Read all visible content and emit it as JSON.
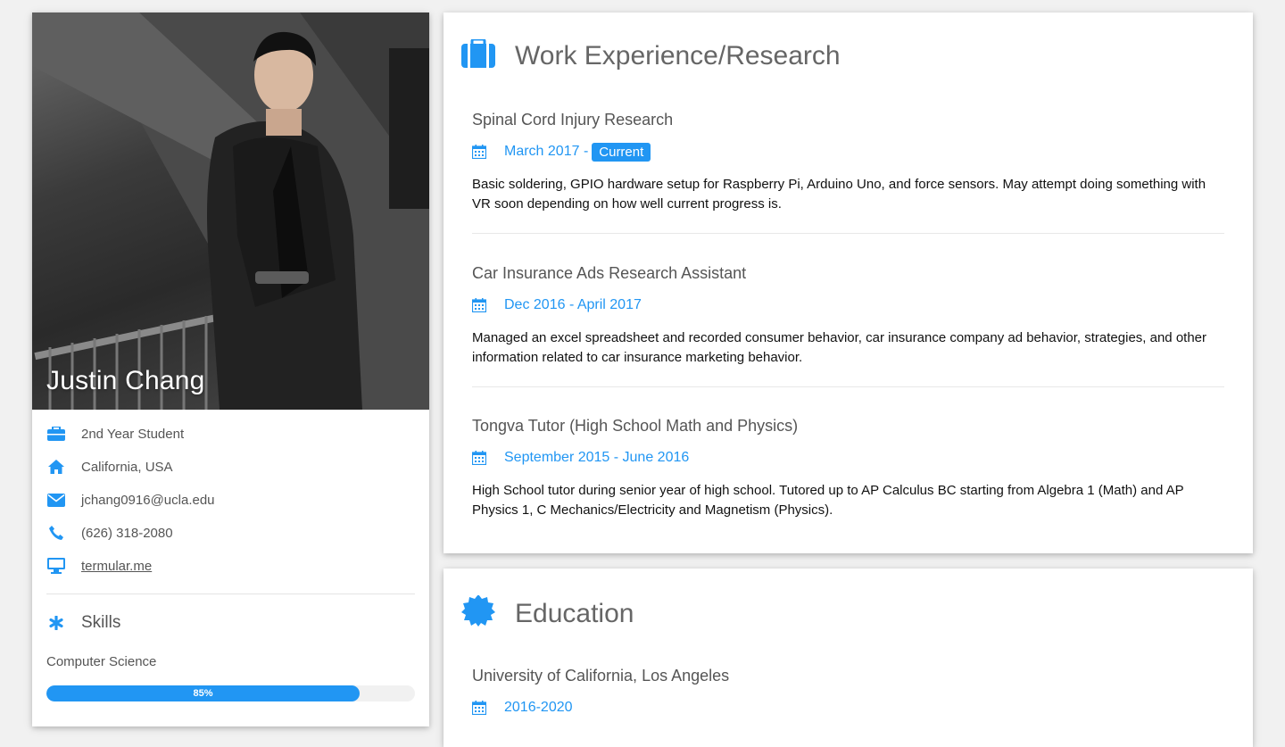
{
  "profile": {
    "name": "Justin Chang",
    "info": [
      {
        "icon": "briefcase-icon",
        "text": "2nd Year Student"
      },
      {
        "icon": "home-icon",
        "text": "California, USA"
      },
      {
        "icon": "envelope-icon",
        "text": "jchang0916@ucla.edu"
      },
      {
        "icon": "phone-icon",
        "text": "(626) 318-2080"
      },
      {
        "icon": "desktop-icon",
        "text": "termular.me"
      }
    ],
    "skills_title": "Skills",
    "skills": [
      {
        "label": "Computer Science",
        "percent": 85,
        "percent_label": "85%"
      }
    ]
  },
  "work": {
    "title": "Work Experience/Research",
    "entries": [
      {
        "title": "Spinal Cord Injury Research",
        "date": "March 2017 -",
        "badge": "Current",
        "description": "Basic soldering, GPIO hardware setup for Raspberry Pi, Arduino Uno, and force sensors. May attempt doing something with VR soon depending on how well current progress is."
      },
      {
        "title": "Car Insurance Ads Research Assistant",
        "date": "Dec 2016 - April 2017",
        "description": "Managed an excel spreadsheet and recorded consumer behavior, car insurance company ad behavior, strategies, and other information related to car insurance marketing behavior."
      },
      {
        "title": "Tongva Tutor (High School Math and Physics)",
        "date": "September 2015 - June 2016",
        "description": "High School tutor during senior year of high school. Tutored up to AP Calculus BC starting from Algebra 1 (Math) and AP Physics 1, C Mechanics/Electricity and Magnetism (Physics)."
      }
    ]
  },
  "education": {
    "title": "Education",
    "entries": [
      {
        "title": "University of California, Los Angeles",
        "date": "2016-2020"
      }
    ]
  },
  "colors": {
    "accent": "#2196F3",
    "background": "#f1f1f1",
    "card": "#ffffff"
  }
}
